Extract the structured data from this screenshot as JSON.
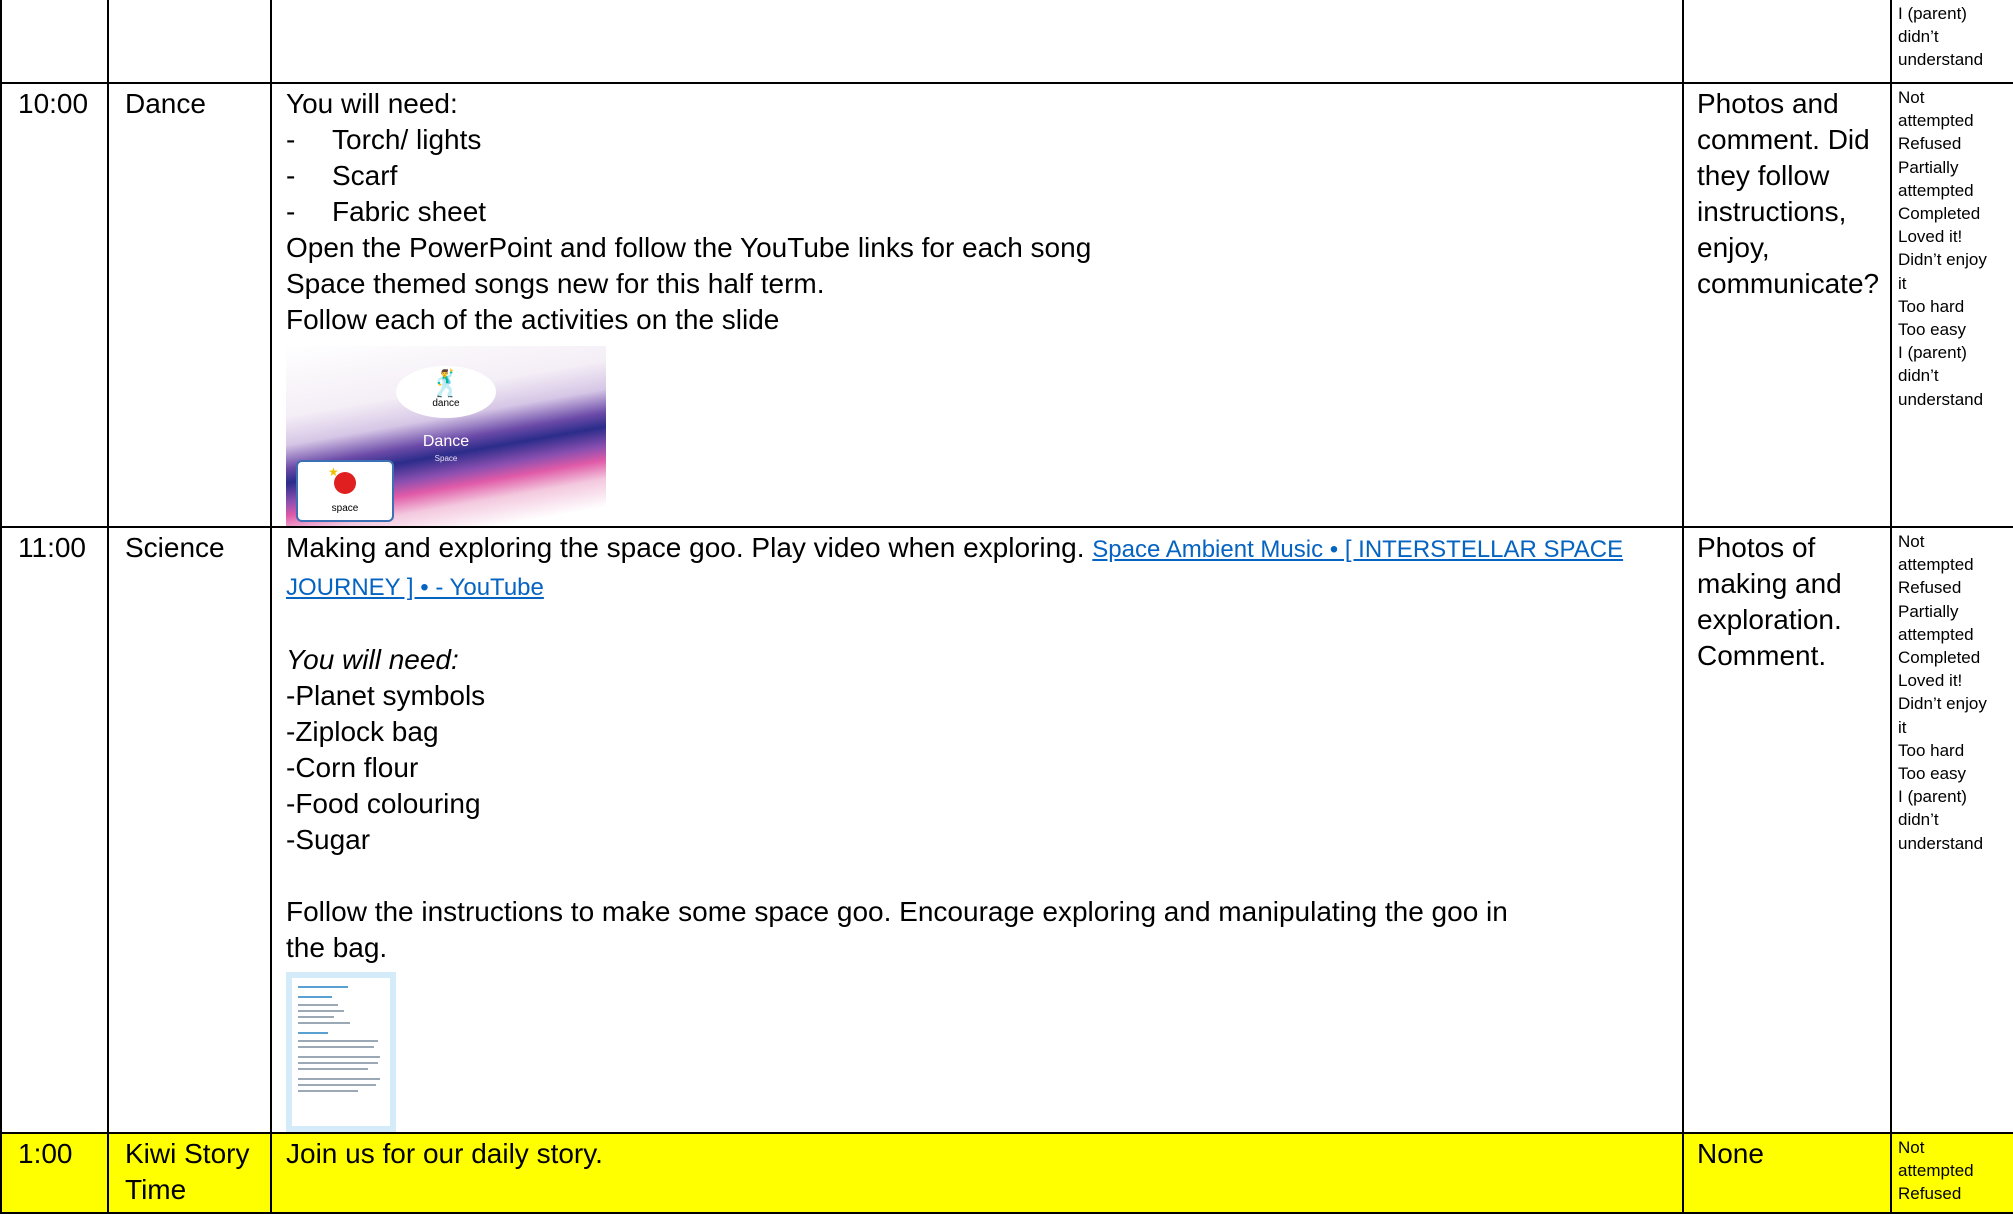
{
  "rows": [
    {
      "time": "",
      "subject": "",
      "activity": [],
      "evidence": "",
      "responses": [
        "I (parent)",
        "didn’t",
        "understand"
      ]
    },
    {
      "time": "10:00",
      "subject": "Dance",
      "activity_intro": "You will need:",
      "activity_items": [
        "Torch/ lights",
        "Scarf",
        "Fabric sheet"
      ],
      "activity_lines": [
        "Open the PowerPoint and follow the YouTube links for each song",
        "Space themed songs new for this half term.",
        "Follow each of the activities on the slide"
      ],
      "image": {
        "symbol_caption": "dance",
        "title": "Dance",
        "subtitle": "Space",
        "card_caption": "space"
      },
      "evidence": "Photos and comment. Did they follow instructions, enjoy, communicate?",
      "responses": [
        "Not",
        "attempted",
        "Refused",
        "Partially",
        "attempted",
        "Completed",
        "Loved it!",
        "Didn’t enjoy",
        "it",
        "Too hard",
        "Too easy",
        "I (parent)",
        "didn’t",
        "understand"
      ]
    },
    {
      "time": "11:00",
      "subject": "Science",
      "activity_text": "Making and exploring the space goo. Play video when exploring. ",
      "activity_link": "Space Ambient Music • [ INTERSTELLAR SPACE JOURNEY ] • - YouTube",
      "need_label": "You will need:",
      "need_items": [
        "-Planet symbols",
        "-Ziplock bag",
        "-Corn flour",
        "-Food colouring",
        "-Sugar"
      ],
      "instructions": "Follow the instructions to make some space goo. Encourage exploring and manipulating the goo in the bag.",
      "evidence": "Photos of making and exploration. Comment.",
      "responses": [
        "Not",
        "attempted",
        "Refused",
        "Partially",
        "attempted",
        "Completed",
        "Loved it!",
        "Didn’t enjoy",
        "it",
        "Too hard",
        "Too easy",
        "I (parent)",
        "didn’t",
        "understand"
      ]
    },
    {
      "time": "1:00",
      "subject": "Kiwi Story Time",
      "activity_text": "Join us for our daily story.",
      "evidence": "None",
      "responses": [
        "Not",
        "attempted",
        "Refused"
      ]
    }
  ],
  "colors": {
    "highlight": "#ffff00",
    "link": "#0563c1",
    "border": "#000000"
  }
}
